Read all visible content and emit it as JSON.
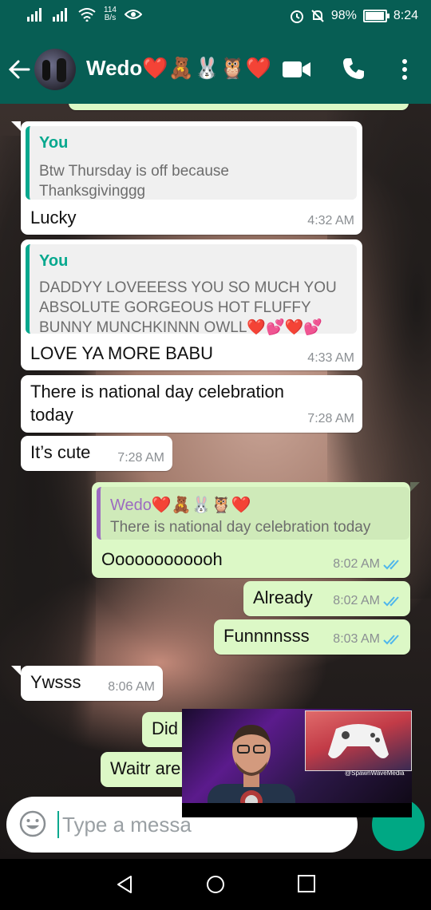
{
  "status_bar": {
    "network_speed": "114",
    "network_unit": "B/s",
    "battery": "98%",
    "battery_level": 0.98,
    "time": "8:24"
  },
  "header": {
    "contact_name": "Wedo❤️🧸🐰🦉❤️"
  },
  "messages": [
    {
      "direction": "in",
      "quoted_from": "You",
      "quoted_text": "Btw Thursday is off because Thanksgivinggg",
      "text": "Lucky",
      "time": "4:32 AM"
    },
    {
      "direction": "in",
      "quoted_from": "You",
      "quoted_text": "DADDYY LOVEEESS YOU SO MUCH YOU ABSOLUTE GORGEOUS HOT FLUFFY BUNNY MUNCHKINNN OWLL❤️💕❤️💕",
      "text": "LOVE YA MORE BABU",
      "time": "4:33 AM"
    },
    {
      "direction": "in",
      "text": "There is national day celebration today",
      "time": "7:28 AM"
    },
    {
      "direction": "in",
      "text": "It’s cute",
      "time": "7:28 AM"
    },
    {
      "direction": "out",
      "quoted_from": "Wedo❤️🧸🐰🦉❤️",
      "quoted_text": "There is national day celebration today",
      "text": "Oooooooooooh",
      "time": "8:02 AM"
    },
    {
      "direction": "out",
      "text": "Already",
      "time": "8:02 AM"
    },
    {
      "direction": "out",
      "text": "Funnnnsss",
      "time": "8:03 AM"
    },
    {
      "direction": "in",
      "text": "Ywsss",
      "time": "8:06 AM"
    },
    {
      "direction": "out",
      "text": "Did",
      "time": ""
    },
    {
      "direction": "out",
      "text": "Waitr are",
      "time": ""
    }
  ],
  "input": {
    "placeholder": "Type a messa"
  },
  "pip": {
    "handle": "@SpawnWaveMedia"
  },
  "colors": {
    "header_bg": "#075e54",
    "outgoing_bubble": "#dcf8c6",
    "incoming_bubble": "#ffffff",
    "accent": "#00a884",
    "read_ticks": "#4fb6ec"
  }
}
